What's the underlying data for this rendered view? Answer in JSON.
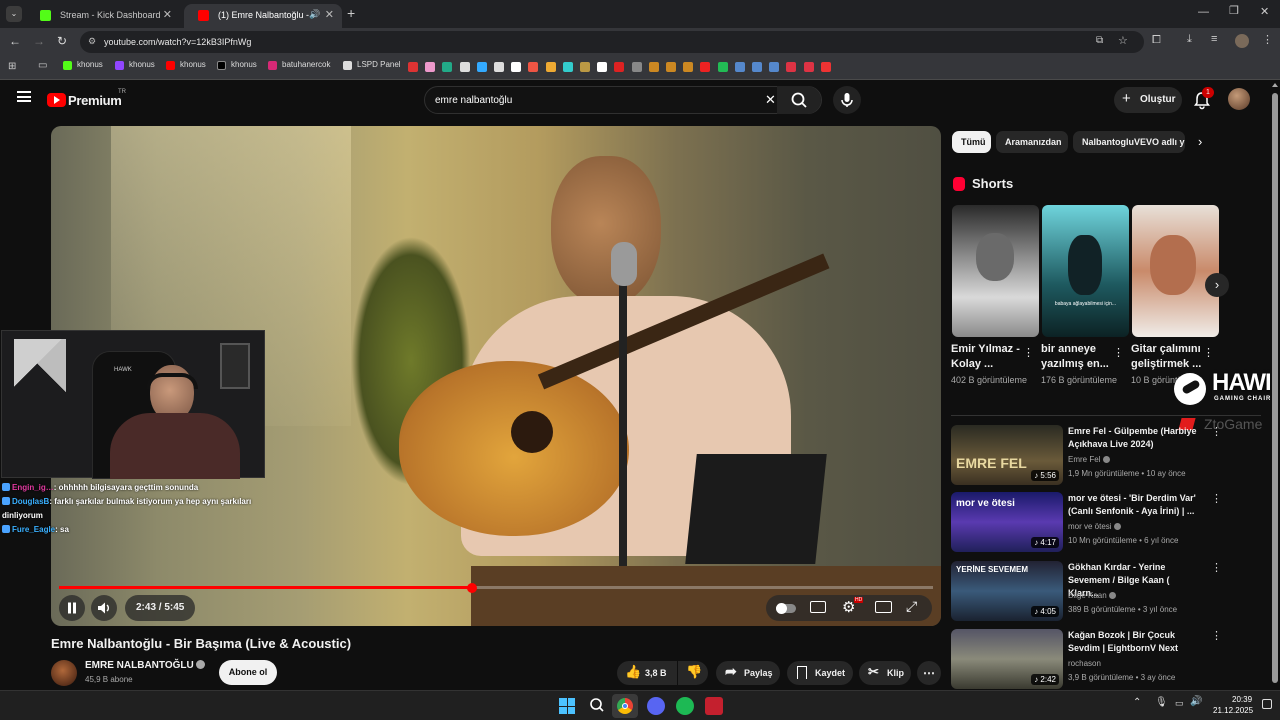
{
  "browser": {
    "tabs": [
      {
        "title": "Stream - Kick Dashboard",
        "active": false
      },
      {
        "title": "(1) Emre Nalbantoğlu - Bir Başıma (Live & Acoustic)",
        "active": true
      }
    ],
    "url": "youtube.com/watch?v=12kB3IPfnWg",
    "bookmarks": [
      "khonus",
      "khonus",
      "khonus",
      "khonus",
      "batuhanercok",
      "LSPD Panel"
    ]
  },
  "header": {
    "logo": "Premium",
    "logo_sup": "TR",
    "search_value": "emre nalbantoğlu",
    "create_label": "Oluştur",
    "notification_count": "1"
  },
  "player": {
    "time": "2:43 / 5:45",
    "progress": 0.472
  },
  "overlay": {
    "chat": [
      {
        "user": "Engin_ig…",
        "text": ": ohhhhh bilgisayara geçttim sonunda",
        "color": "#e23aa0"
      },
      {
        "user": "DouglasB",
        "text": ": farklı şarkılar bulmak istiyorum ya hep aynı şarkıları dinliyorum",
        "color": "#3ab0ff"
      },
      {
        "user": "Fure_Eagle",
        "text": ": sa",
        "color": "#3ab0ff"
      }
    ],
    "hawk_title": "HAWK",
    "hawk_sub": "GAMING CHAIR",
    "hawk_extra": "ZtoGame"
  },
  "video": {
    "title": "Emre Nalbantoğlu - Bir Başıma (Live & Acoustic)",
    "channel": "EMRE NALBANTOĞLU",
    "subscribers": "45,9 B abone",
    "subscribe_label": "Abone ol",
    "likes": "3,8 B",
    "share_label": "Paylaş",
    "save_label": "Kaydet",
    "clip_label": "Klip"
  },
  "sidebar": {
    "chips": [
      "Tümü",
      "Aramanızdan",
      "NalbantogluVEVO adlı yükleyiciden"
    ],
    "shorts_title": "Shorts",
    "shorts": [
      {
        "title": "Emir Yılmaz - Kolay ...",
        "views": "402 B görüntüleme",
        "caption": ""
      },
      {
        "title": "bir anneye yazılmış en...",
        "views": "176 B görüntüleme",
        "caption": "babaya ağlayabilmesi için..."
      },
      {
        "title": "Gitar çalımını geliştirmek ...",
        "views": "10 B görüntüleme",
        "caption": ""
      }
    ],
    "recommendations": [
      {
        "title": "Emre Fel - Gülpembe (Harbiye Açıkhava Live 2024)",
        "channel": "Emre Fel",
        "meta": "1,9 Mn görüntüleme • 10 ay önce",
        "duration": "5:56",
        "thumb_text": "EMRE FEL"
      },
      {
        "title": "mor ve ötesi - 'Bir Derdim Var' (Canlı Senfonik - Aya İrini) | ...",
        "channel": "mor ve ötesi",
        "meta": "10 Mn görüntüleme • 6 yıl önce",
        "duration": "4:17",
        "thumb_text": "mor ve ötesi"
      },
      {
        "title": "Gökhan Kırdar - Yerine Sevemem / Bilge Kaan ( Klarn...",
        "channel": "Bilge Kaan",
        "meta": "389 B görüntüleme • 3 yıl önce",
        "duration": "4:05",
        "thumb_text": "YERİNE SEVEMEM"
      },
      {
        "title": "Kağan Bozok | Bir Çocuk Sevdim | EightbornV Next",
        "channel": "rochason",
        "meta": "3,9 B görüntüleme • 3 ay önce",
        "duration": "2:42",
        "thumb_text": ""
      }
    ]
  },
  "taskbar": {
    "time": "20:39",
    "date": "21.12.2025",
    "lang": "TR"
  },
  "colors": {
    "accent": "#ff0000",
    "background": "#0f0f0f",
    "chip": "#272727"
  }
}
